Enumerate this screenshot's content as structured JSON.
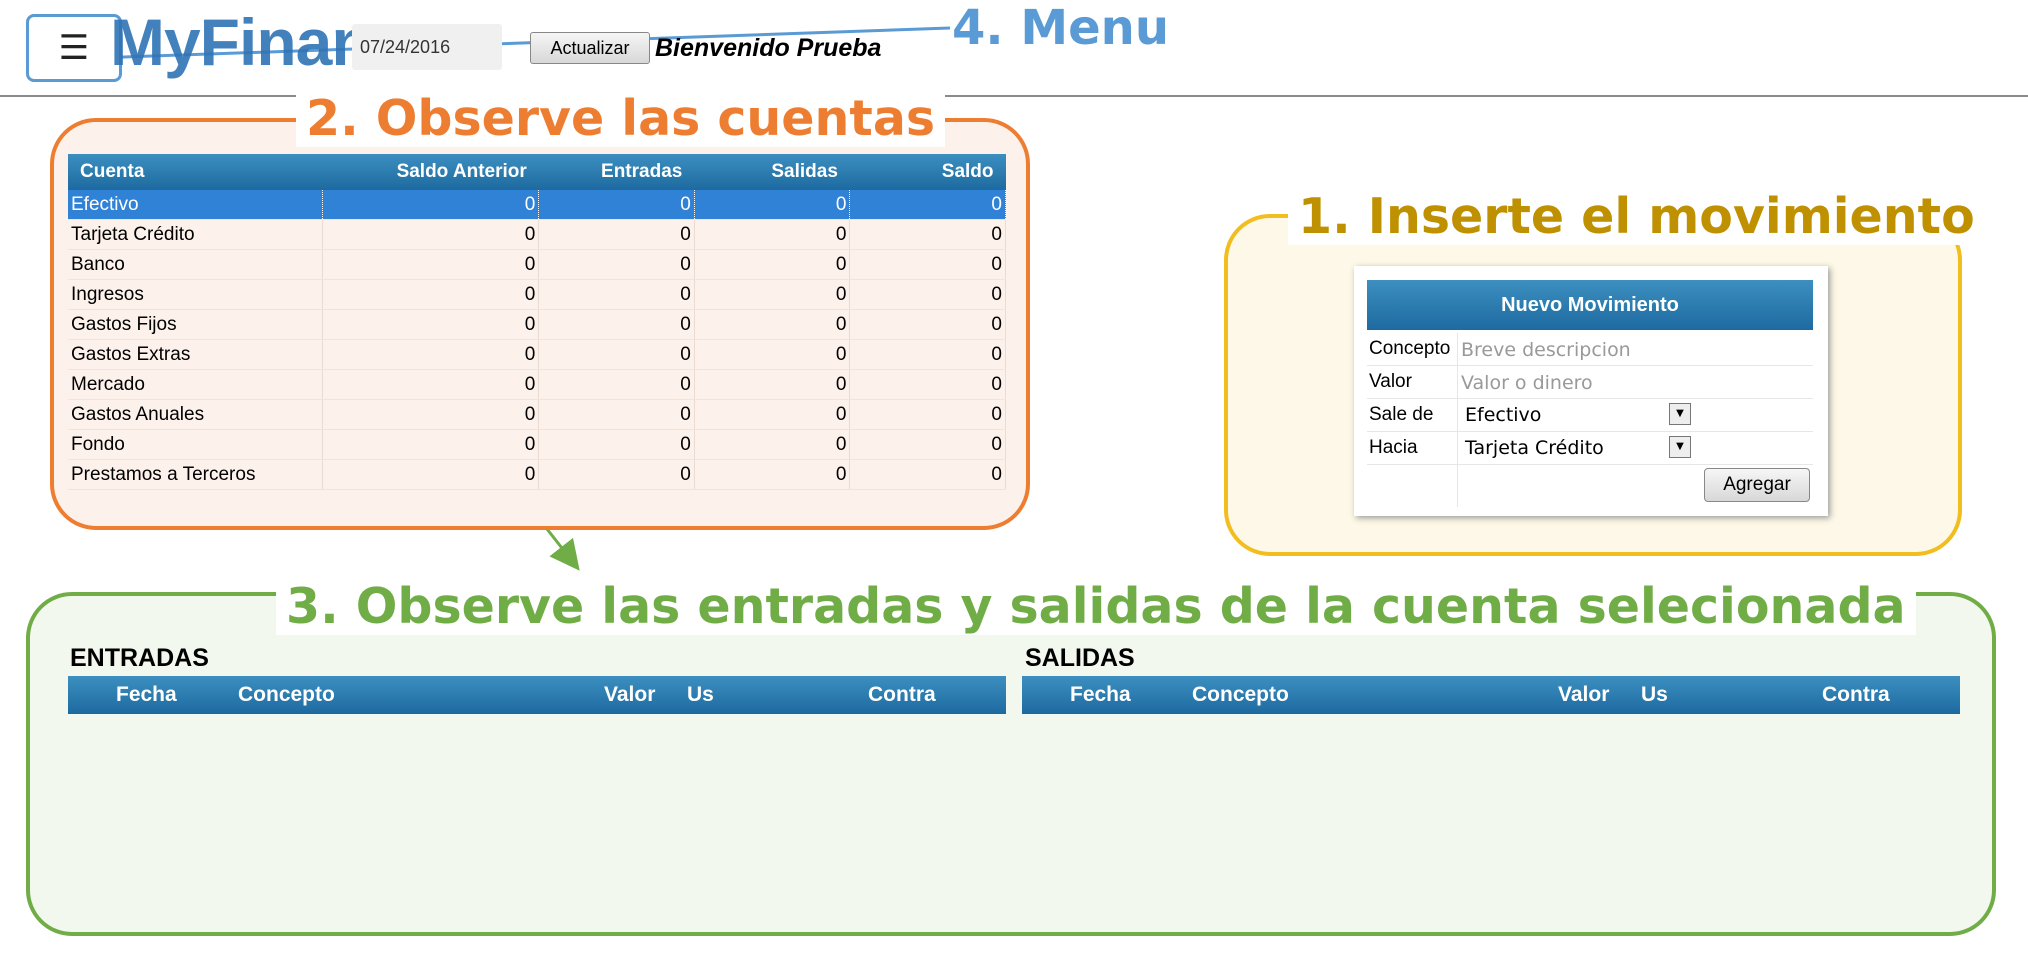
{
  "header": {
    "menu_icon": "☰",
    "logo": "MyFinan",
    "date": "07/24/2016",
    "refresh_label": "Actualizar",
    "welcome": "Bienvenido Prueba"
  },
  "callouts": {
    "menu": "4. Menu",
    "accounts": "2. Observe las cuentas",
    "insert": "1. Inserte el movimiento",
    "movements": "3. Observe las entradas y salidas de la cuenta selecionada"
  },
  "colors": {
    "menu": "#5b9bd5",
    "accounts": "#ed7d31",
    "insert": "#f2bd1e",
    "movements": "#70ad47",
    "table_header": "#1d6aa0",
    "selected_row": "#2f82d6"
  },
  "accounts": {
    "columns": [
      "Cuenta",
      "Saldo Anterior",
      "Entradas",
      "Salidas",
      "Saldo"
    ],
    "rows": [
      {
        "cuenta": "Efectivo",
        "saldo_anterior": "0",
        "entradas": "0",
        "salidas": "0",
        "saldo": "0",
        "selected": true
      },
      {
        "cuenta": "Tarjeta Crédito",
        "saldo_anterior": "0",
        "entradas": "0",
        "salidas": "0",
        "saldo": "0"
      },
      {
        "cuenta": "Banco",
        "saldo_anterior": "0",
        "entradas": "0",
        "salidas": "0",
        "saldo": "0"
      },
      {
        "cuenta": "Ingresos",
        "saldo_anterior": "0",
        "entradas": "0",
        "salidas": "0",
        "saldo": "0"
      },
      {
        "cuenta": "Gastos Fijos",
        "saldo_anterior": "0",
        "entradas": "0",
        "salidas": "0",
        "saldo": "0"
      },
      {
        "cuenta": "Gastos Extras",
        "saldo_anterior": "0",
        "entradas": "0",
        "salidas": "0",
        "saldo": "0"
      },
      {
        "cuenta": "Mercado",
        "saldo_anterior": "0",
        "entradas": "0",
        "salidas": "0",
        "saldo": "0"
      },
      {
        "cuenta": "Gastos Anuales",
        "saldo_anterior": "0",
        "entradas": "0",
        "salidas": "0",
        "saldo": "0"
      },
      {
        "cuenta": "Fondo",
        "saldo_anterior": "0",
        "entradas": "0",
        "salidas": "0",
        "saldo": "0"
      },
      {
        "cuenta": "Prestamos a Terceros",
        "saldo_anterior": "0",
        "entradas": "0",
        "salidas": "0",
        "saldo": "0"
      }
    ]
  },
  "new_movement": {
    "title": "Nuevo Movimiento",
    "concepto_label": "Concepto",
    "concepto_placeholder": "Breve descripcion",
    "valor_label": "Valor",
    "valor_placeholder": "Valor o dinero",
    "sale_de_label": "Sale de",
    "sale_de_value": "Efectivo",
    "hacia_label": "Hacia",
    "hacia_value": "Tarjeta Crédito",
    "add_label": "Agregar"
  },
  "entradas": {
    "title": "ENTRADAS",
    "columns": {
      "fecha": "Fecha",
      "concepto": "Concepto",
      "valor": "Valor",
      "us": "Us",
      "contra": "Contra"
    }
  },
  "salidas": {
    "title": "SALIDAS",
    "columns": {
      "fecha": "Fecha",
      "concepto": "Concepto",
      "valor": "Valor",
      "us": "Us",
      "contra": "Contra"
    }
  }
}
